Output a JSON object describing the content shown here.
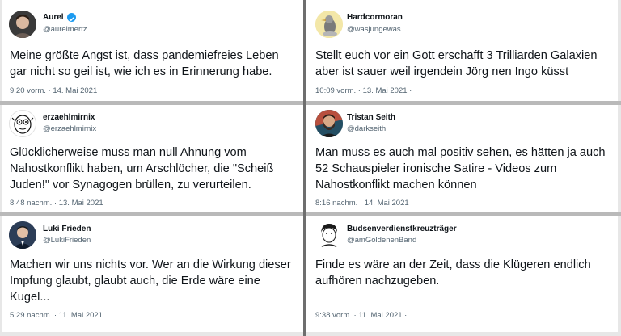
{
  "tweets": [
    {
      "name": "Aurel",
      "handle": "@aurelmertz",
      "verified": true,
      "avatar_icon": "person-portrait",
      "lines": [
        "Meine größte Angst ist, dass pandemiefreies Leben",
        "gar nicht so geil ist, wie ich es in Erinnerung habe."
      ],
      "meta": "9:20 vorm. · 14. Mai 2021"
    },
    {
      "name": "Hardcormoran",
      "handle": "@wasjungewas",
      "verified": false,
      "avatar_icon": "bird-portrait",
      "lines": [
        "Stellt euch vor ein Gott erschafft 3 Trilliarden Galaxien",
        "aber ist sauer weil irgendein Jörg nen Ingo küsst"
      ],
      "meta": "10:09 vorm. · 13. Mai 2021 ·"
    },
    {
      "name": "erzaehlmirnix",
      "handle": "@erzaehlmirnix",
      "verified": false,
      "avatar_icon": "cartoon-face",
      "lines": [
        "Glücklicherweise muss man null Ahnung vom",
        "Nahostkonflikt haben, um Arschlöcher, die \"Scheiß",
        "Juden!\" vor Synagogen brüllen, zu verurteilen."
      ],
      "meta": "8:48 nachm. · 13. Mai 2021"
    },
    {
      "name": "Tristan Seith",
      "handle": "@darkseith",
      "verified": false,
      "avatar_icon": "bearded-portrait",
      "lines": [
        "Man muss es auch mal positiv sehen, es hätten ja auch",
        "52 Schauspieler ironische Satire - Videos zum",
        "Nahostkonflikt machen können"
      ],
      "meta": "8:16 nachm. · 14. Mai 2021"
    },
    {
      "name": "Luki Frieden",
      "handle": "@LukiFrieden",
      "verified": false,
      "avatar_icon": "person-portrait",
      "lines": [
        "Machen wir uns nichts vor. Wer an die Wirkung dieser",
        "Impfung glaubt, glaubt auch, die Erde wäre eine",
        "Kugel..."
      ],
      "meta": "5:29 nachm. · 11. Mai 2021"
    },
    {
      "name": "Budsenverdienstkreuzträger",
      "handle": "@amGoldenenBand",
      "verified": false,
      "avatar_icon": "sketch-portrait",
      "lines": [
        "Finde es wäre an der Zeit, dass die Klügeren endlich",
        "aufhören nachzugeben."
      ],
      "meta": "9:38 vorm. · 11. Mai 2021 ·"
    }
  ],
  "colors": {
    "text": "#0f1419",
    "secondary": "#536471",
    "verified": "#1d9bf0",
    "divider_vertical": "#6e6e6e",
    "divider_horizontal": "#b9b9b9"
  }
}
